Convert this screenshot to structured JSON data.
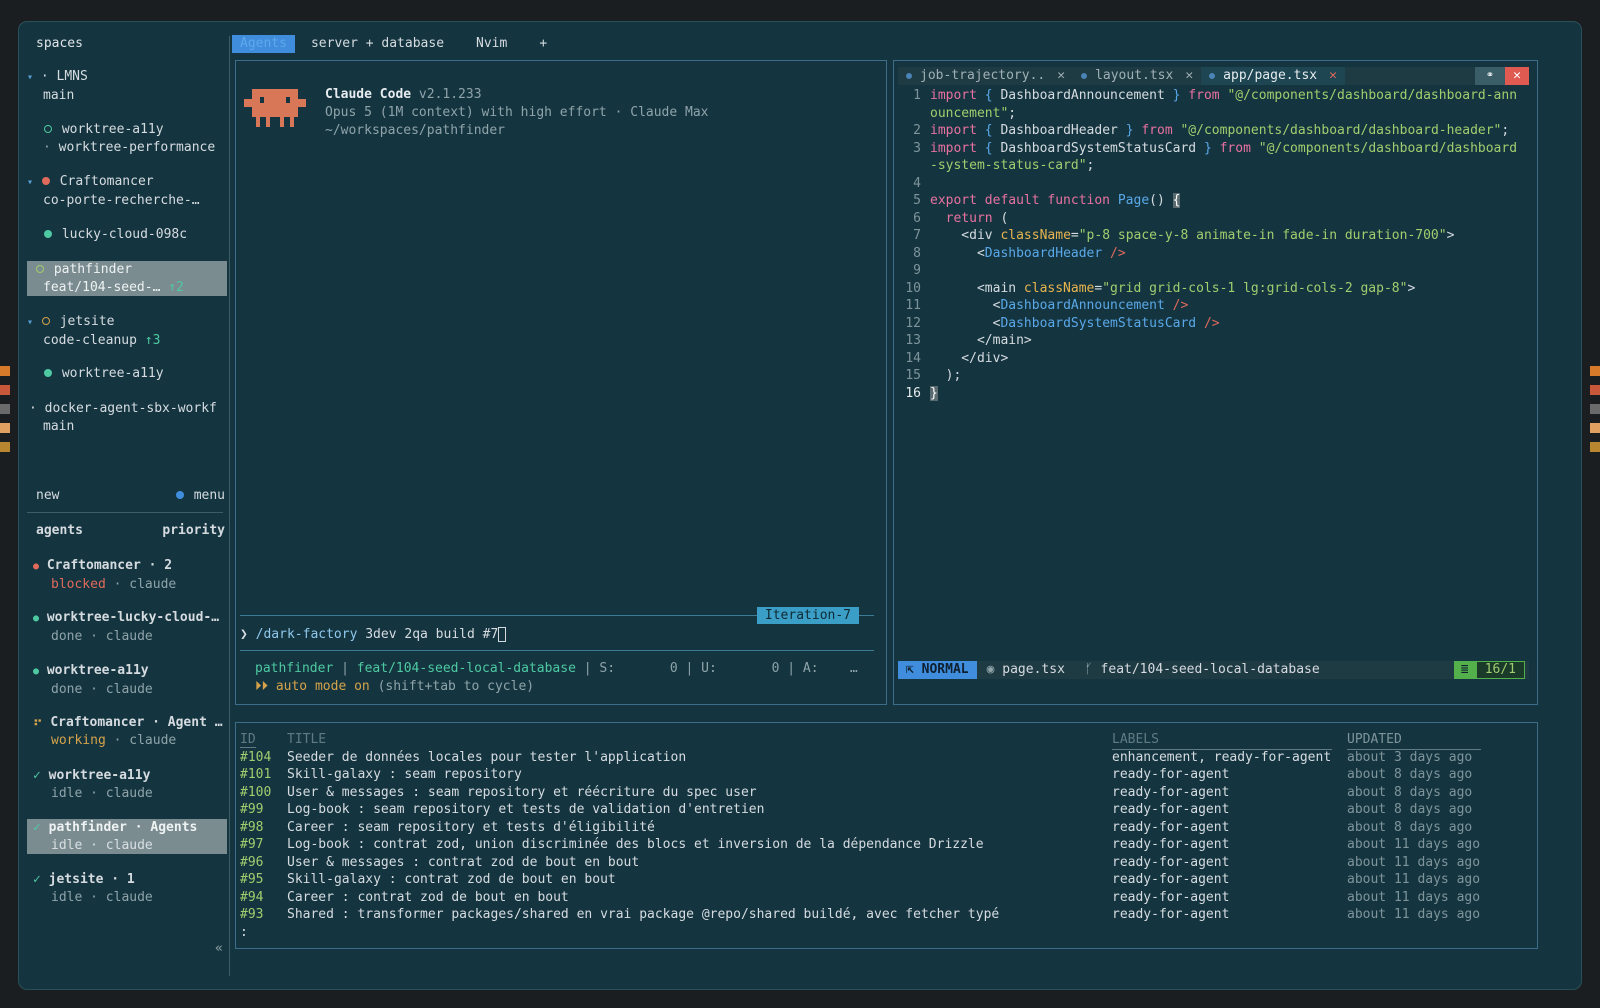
{
  "sidebar": {
    "spaces_label": "spaces",
    "workspaces": [
      {
        "caret": "▾",
        "bullet": "·",
        "name": "LMNS",
        "branch": "main"
      },
      {
        "name": "worktree-a11y",
        "branch": "worktree-performance"
      },
      {
        "caret": "▾",
        "name": "Craftomancer",
        "branch": "co-porte-recherche-…"
      },
      {
        "name": "lucky-cloud-098c"
      },
      {
        "name": "pathfinder",
        "branch": "feat/104-seed-…",
        "badge": "↑2"
      },
      {
        "caret": "▾",
        "name": "jetsite",
        "branch": "code-cleanup",
        "badge": "↑3"
      },
      {
        "name": "worktree-a11y"
      },
      {
        "bullet": "·",
        "name": "docker-agent-sbx-workf",
        "branch": "main"
      }
    ],
    "new_label": "new",
    "menu_label": "menu",
    "agents_label": "agents",
    "priority_label": "priority",
    "agents": [
      {
        "name": "Craftomancer · 2",
        "status": "blocked",
        "tool": "claude",
        "indicator": "●"
      },
      {
        "name": "worktree-lucky-cloud-…",
        "status": "done",
        "tool": "claude",
        "indicator": "●"
      },
      {
        "name": "worktree-a11y",
        "status": "done",
        "tool": "claude",
        "indicator": "●"
      },
      {
        "name": "Craftomancer · Agent …",
        "status": "working",
        "tool": "claude",
        "indicator": "⠖"
      },
      {
        "name": "worktree-a11y",
        "status": "idle",
        "tool": "claude",
        "indicator": "✓"
      },
      {
        "name": "pathfinder · Agents",
        "status": "idle",
        "tool": "claude",
        "indicator": "✓"
      },
      {
        "name": "jetsite · 1",
        "status": "idle",
        "tool": "claude",
        "indicator": "✓"
      }
    ],
    "sep": " · ",
    "collapse": "«"
  },
  "tabs": [
    "Agents",
    "server + database",
    "Nvim",
    "+"
  ],
  "claude": {
    "title": "Claude Code",
    "version": "v2.1.233",
    "model": "Opus 5 (1M context) with high effort · Claude Max",
    "path": "~/workspaces/pathfinder",
    "iteration": "Iteration-7",
    "prompt_symbol": "❯",
    "prompt_cmd": "/dark-factory",
    "prompt_args": " 3dev 2qa build #7",
    "status_repo": "pathfinder",
    "status_branch": "feat/104-seed-local-database",
    "status_rest": " | S:       0 | U:       0 | A:    …",
    "auto_icon": "⏵⏵",
    "auto_text": "auto mode on",
    "auto_hint": " (shift+tab to cycle)"
  },
  "editor": {
    "tabs": [
      {
        "name": "job-trajectory..",
        "close": "✕"
      },
      {
        "name": "layout.tsx",
        "close": "✕"
      },
      {
        "name": "app/page.tsx",
        "close": "✕"
      }
    ],
    "ctrl1": "⚭",
    "ctrl2": "✕",
    "mode": "NORMAL",
    "file": "page.tsx",
    "branch": "feat/104-seed-local-database",
    "position": "16/1"
  },
  "issues": {
    "headers": [
      "ID",
      "TITLE",
      "LABELS",
      "UPDATED"
    ],
    "rows": [
      {
        "id": "#104",
        "title": "Seeder de données locales pour tester l'application",
        "labels": "enhancement, ready-for-agent",
        "updated": "about 3 days ago"
      },
      {
        "id": "#101",
        "title": "Skill-galaxy : seam repository",
        "labels": "ready-for-agent",
        "updated": "about 8 days ago"
      },
      {
        "id": "#100",
        "title": "User & messages : seam repository et réécriture du spec user",
        "labels": "ready-for-agent",
        "updated": "about 8 days ago"
      },
      {
        "id": "#99",
        "title": "Log-book : seam repository et tests de validation d'entretien",
        "labels": "ready-for-agent",
        "updated": "about 8 days ago"
      },
      {
        "id": "#98",
        "title": "Career : seam repository et tests d'éligibilité",
        "labels": "ready-for-agent",
        "updated": "about 8 days ago"
      },
      {
        "id": "#97",
        "title": "Log-book : contrat zod, union discriminée des blocs et inversion de la dépendance Drizzle",
        "labels": "ready-for-agent",
        "updated": "about 11 days ago"
      },
      {
        "id": "#96",
        "title": "User & messages : contrat zod de bout en bout",
        "labels": "ready-for-agent",
        "updated": "about 11 days ago"
      },
      {
        "id": "#95",
        "title": "Skill-galaxy : contrat zod de bout en bout",
        "labels": "ready-for-agent",
        "updated": "about 11 days ago"
      },
      {
        "id": "#94",
        "title": "Career : contrat zod de bout en bout",
        "labels": "ready-for-agent",
        "updated": "about 11 days ago"
      },
      {
        "id": "#93",
        "title": "Shared : transformer packages/shared en vrai package @repo/shared buildé, avec fetcher typé",
        "labels": "ready-for-agent",
        "updated": "about 11 days ago"
      }
    ],
    "prompt": ":"
  },
  "colors": {
    "accent": "#3f8ddc",
    "bg": "#143540",
    "green": "#4ec9a1",
    "red": "#e06a5b",
    "orange": "#d6a24a"
  }
}
